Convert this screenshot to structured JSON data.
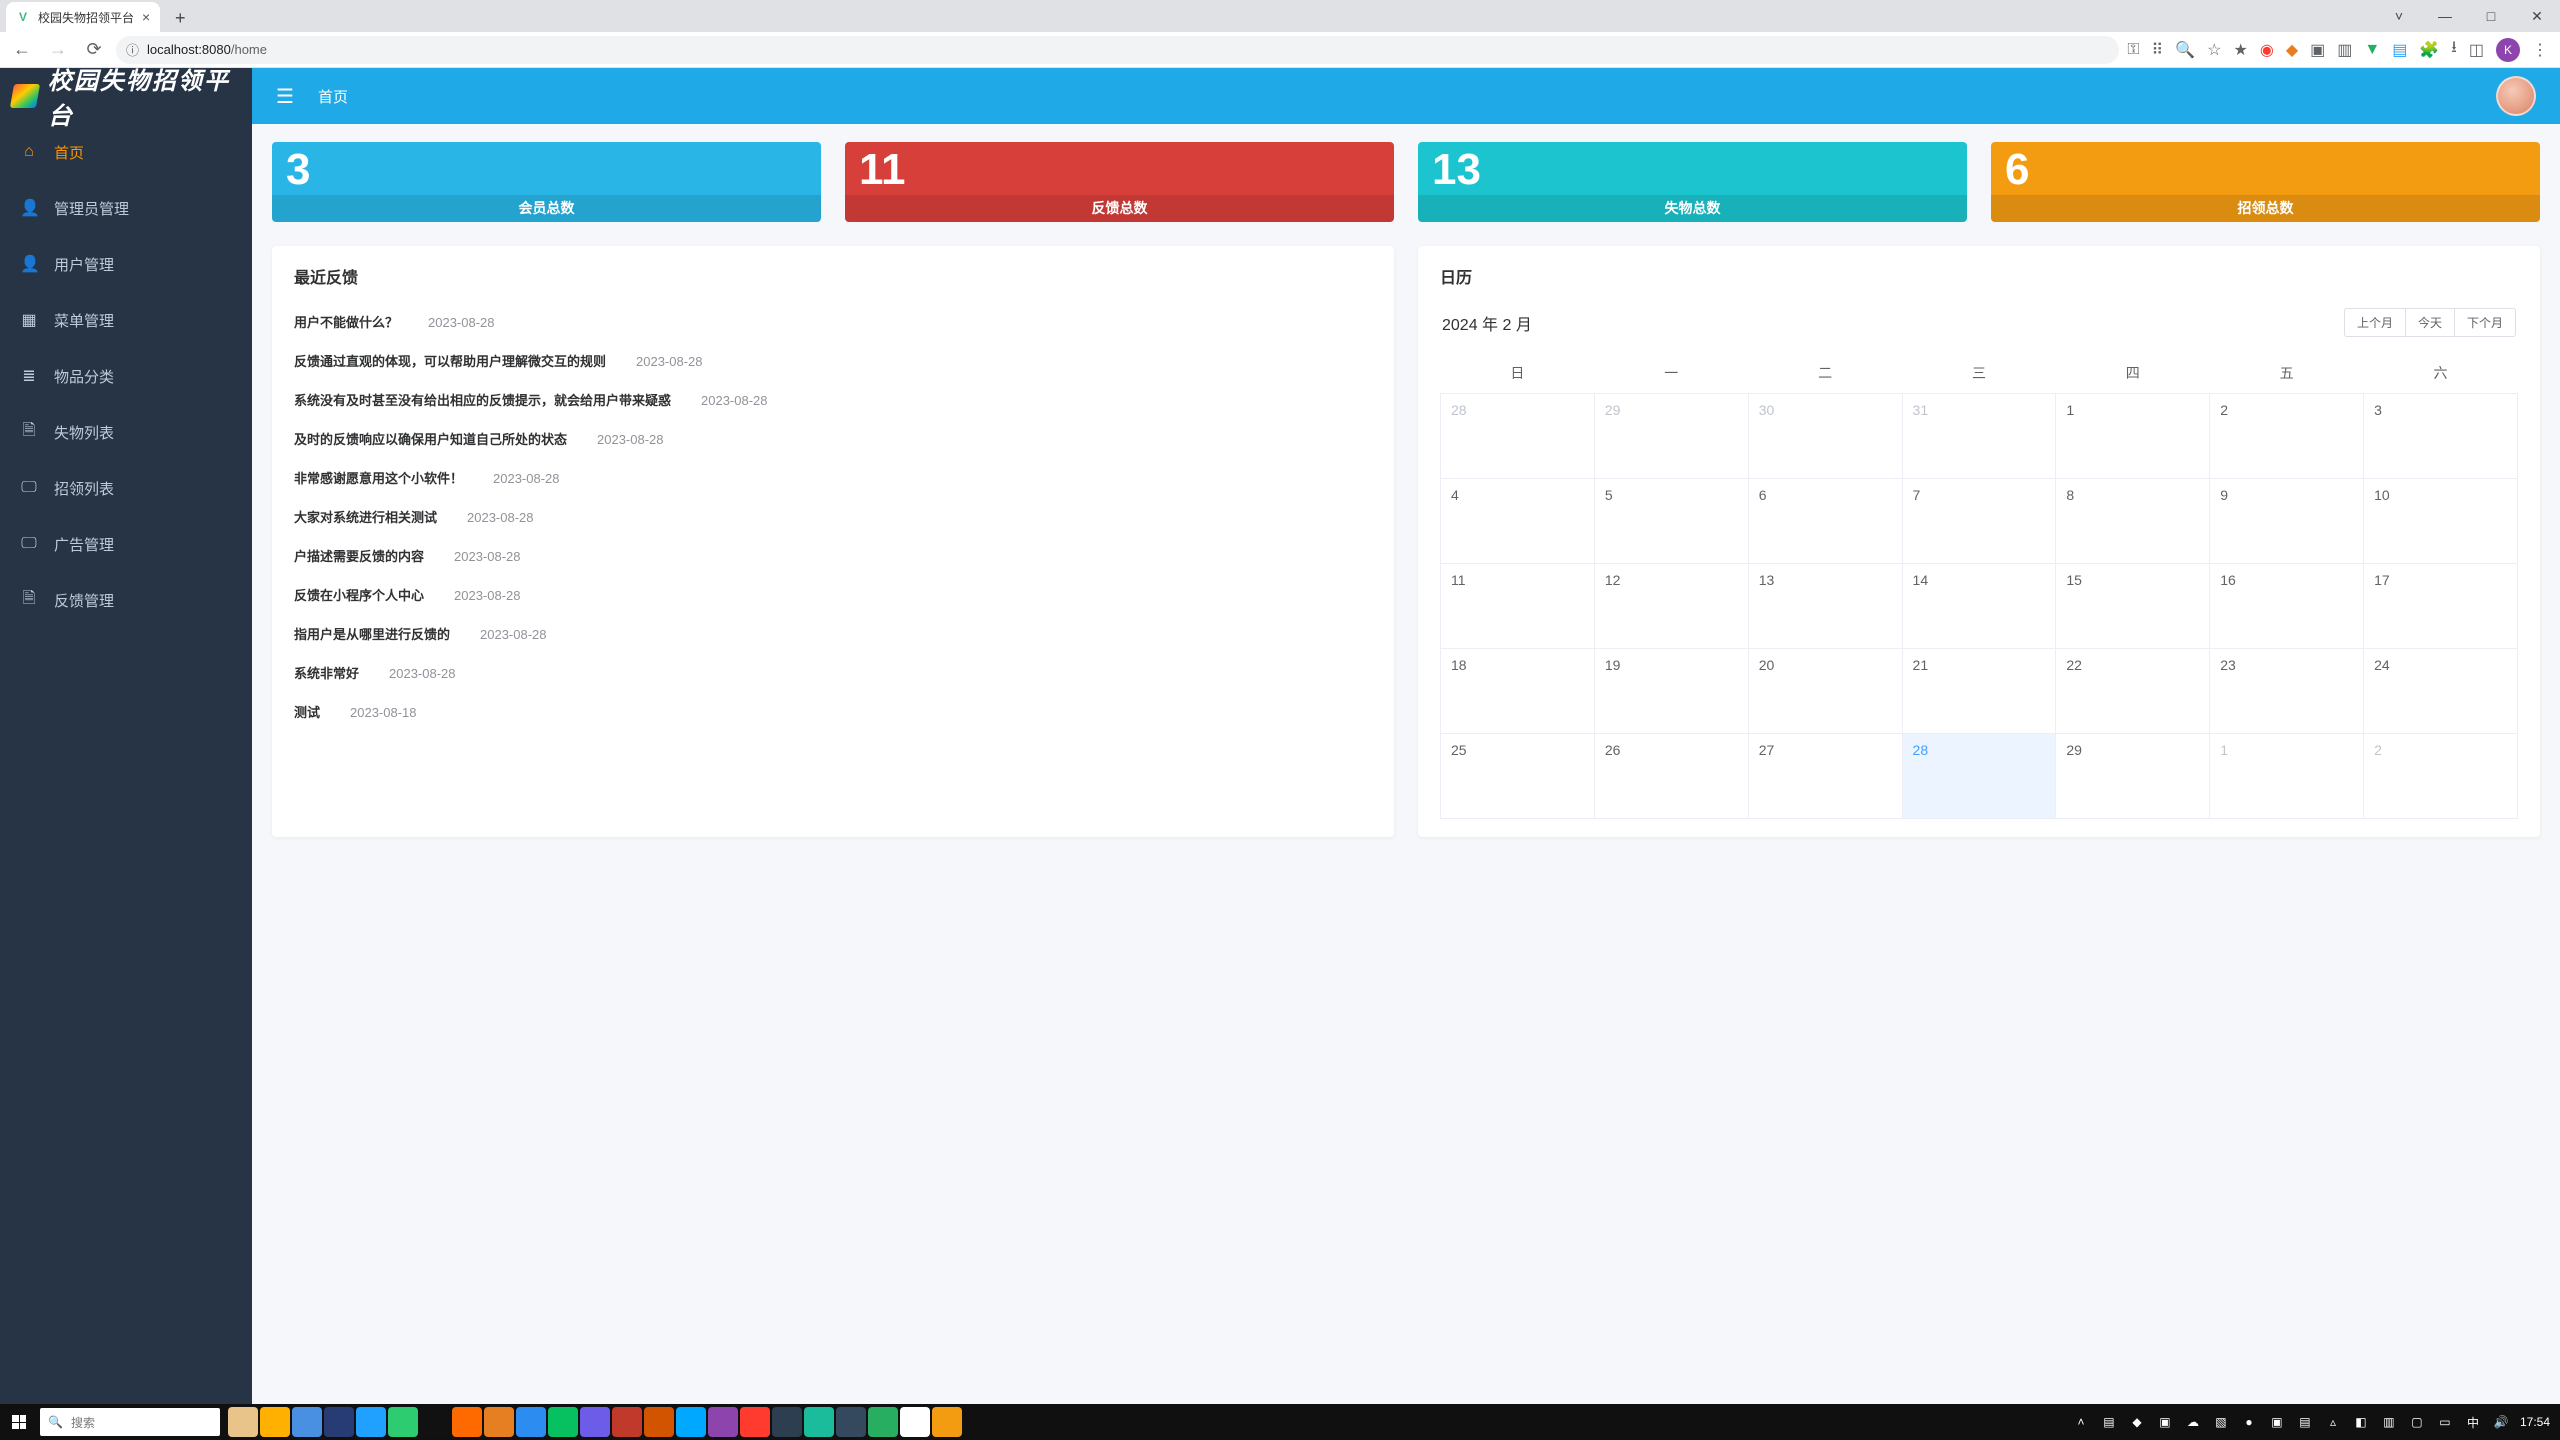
{
  "browser": {
    "tab_title": "校园失物招领平台",
    "url_host": "localhost:8080",
    "url_path": "/home",
    "avatar_letter": "K"
  },
  "app_title": "校园失物招领平台",
  "topbar": {
    "breadcrumb": "首页"
  },
  "sidebar": {
    "items": [
      {
        "icon": "home-icon",
        "glyph": "⌂",
        "label": "首页",
        "active": true
      },
      {
        "icon": "admin-icon",
        "glyph": "👤",
        "label": "管理员管理",
        "active": false
      },
      {
        "icon": "user-icon",
        "glyph": "👤",
        "label": "用户管理",
        "active": false
      },
      {
        "icon": "menu-icon",
        "glyph": "▦",
        "label": "菜单管理",
        "active": false
      },
      {
        "icon": "category-icon",
        "glyph": "≣",
        "label": "物品分类",
        "active": false
      },
      {
        "icon": "lost-icon",
        "glyph": "🗎",
        "label": "失物列表",
        "active": false
      },
      {
        "icon": "found-icon",
        "glyph": "🖵",
        "label": "招领列表",
        "active": false
      },
      {
        "icon": "ad-icon",
        "glyph": "🖵",
        "label": "广告管理",
        "active": false
      },
      {
        "icon": "feedback-icon",
        "glyph": "🗎",
        "label": "反馈管理",
        "active": false
      }
    ]
  },
  "stats": [
    {
      "num": "3",
      "label": "会员总数",
      "cls": "c1"
    },
    {
      "num": "11",
      "label": "反馈总数",
      "cls": "c2"
    },
    {
      "num": "13",
      "label": "失物总数",
      "cls": "c3"
    },
    {
      "num": "6",
      "label": "招领总数",
      "cls": "c4"
    }
  ],
  "feedback": {
    "title": "最近反馈",
    "items": [
      {
        "text": "用户不能做什么？",
        "date": "2023-08-28"
      },
      {
        "text": "反馈通过直观的体现，可以帮助用户理解微交互的规则",
        "date": "2023-08-28"
      },
      {
        "text": "系统没有及时甚至没有给出相应的反馈提示，就会给用户带来疑惑",
        "date": "2023-08-28"
      },
      {
        "text": "及时的反馈响应以确保用户知道自己所处的状态",
        "date": "2023-08-28"
      },
      {
        "text": "非常感谢愿意用这个小软件！",
        "date": "2023-08-28"
      },
      {
        "text": "大家对系统进行相关测试",
        "date": "2023-08-28"
      },
      {
        "text": "户描述需要反馈的内容",
        "date": "2023-08-28"
      },
      {
        "text": "反馈在小程序个人中心",
        "date": "2023-08-28"
      },
      {
        "text": "指用户是从哪里进行反馈的",
        "date": "2023-08-28"
      },
      {
        "text": "系统非常好",
        "date": "2023-08-28"
      },
      {
        "text": "测试",
        "date": "2023-08-18"
      }
    ]
  },
  "calendar": {
    "title": "日历",
    "month_label": "2024 年 2 月",
    "btn_prev": "上个月",
    "btn_today": "今天",
    "btn_next": "下个月",
    "weekdays": [
      "日",
      "一",
      "二",
      "三",
      "四",
      "五",
      "六"
    ],
    "weeks": [
      [
        {
          "d": "28",
          "other": true
        },
        {
          "d": "29",
          "other": true
        },
        {
          "d": "30",
          "other": true
        },
        {
          "d": "31",
          "other": true
        },
        {
          "d": "1"
        },
        {
          "d": "2"
        },
        {
          "d": "3"
        }
      ],
      [
        {
          "d": "4"
        },
        {
          "d": "5"
        },
        {
          "d": "6"
        },
        {
          "d": "7"
        },
        {
          "d": "8"
        },
        {
          "d": "9"
        },
        {
          "d": "10"
        }
      ],
      [
        {
          "d": "11"
        },
        {
          "d": "12"
        },
        {
          "d": "13"
        },
        {
          "d": "14"
        },
        {
          "d": "15"
        },
        {
          "d": "16"
        },
        {
          "d": "17"
        }
      ],
      [
        {
          "d": "18"
        },
        {
          "d": "19"
        },
        {
          "d": "20"
        },
        {
          "d": "21"
        },
        {
          "d": "22"
        },
        {
          "d": "23"
        },
        {
          "d": "24"
        }
      ],
      [
        {
          "d": "25"
        },
        {
          "d": "26"
        },
        {
          "d": "27"
        },
        {
          "d": "28",
          "today": true
        },
        {
          "d": "29"
        },
        {
          "d": "1",
          "other": true
        },
        {
          "d": "2",
          "other": true
        }
      ]
    ]
  },
  "taskbar": {
    "search_placeholder": "搜索",
    "time": "17:54",
    "app_icons": [
      {
        "bg": "#e8c38a"
      },
      {
        "bg": "#ffb000"
      },
      {
        "bg": "#4a90e2"
      },
      {
        "bg": "#273c75"
      },
      {
        "bg": "#20a0ff"
      },
      {
        "bg": "#2ecc71"
      },
      {
        "bg": "#111111"
      },
      {
        "bg": "#ff6a00"
      },
      {
        "bg": "#e67e22"
      },
      {
        "bg": "#2d8cf0"
      },
      {
        "bg": "#07c160"
      },
      {
        "bg": "#6c5ce7"
      },
      {
        "bg": "#c0392b"
      },
      {
        "bg": "#d35400"
      },
      {
        "bg": "#00a8ff"
      },
      {
        "bg": "#8e44ad"
      },
      {
        "bg": "#ff3b30"
      },
      {
        "bg": "#2c3e50"
      },
      {
        "bg": "#1abc9c"
      },
      {
        "bg": "#34495e"
      },
      {
        "bg": "#27ae60"
      },
      {
        "bg": "#ffffff"
      },
      {
        "bg": "#f39c12"
      }
    ],
    "tray_icons": [
      "˄",
      "▤",
      "◆",
      "▣",
      "☁",
      "▧",
      "●",
      "▣",
      "▤",
      "▵",
      "◧",
      "▥",
      "▢",
      "▭",
      "中",
      "🔊"
    ]
  }
}
